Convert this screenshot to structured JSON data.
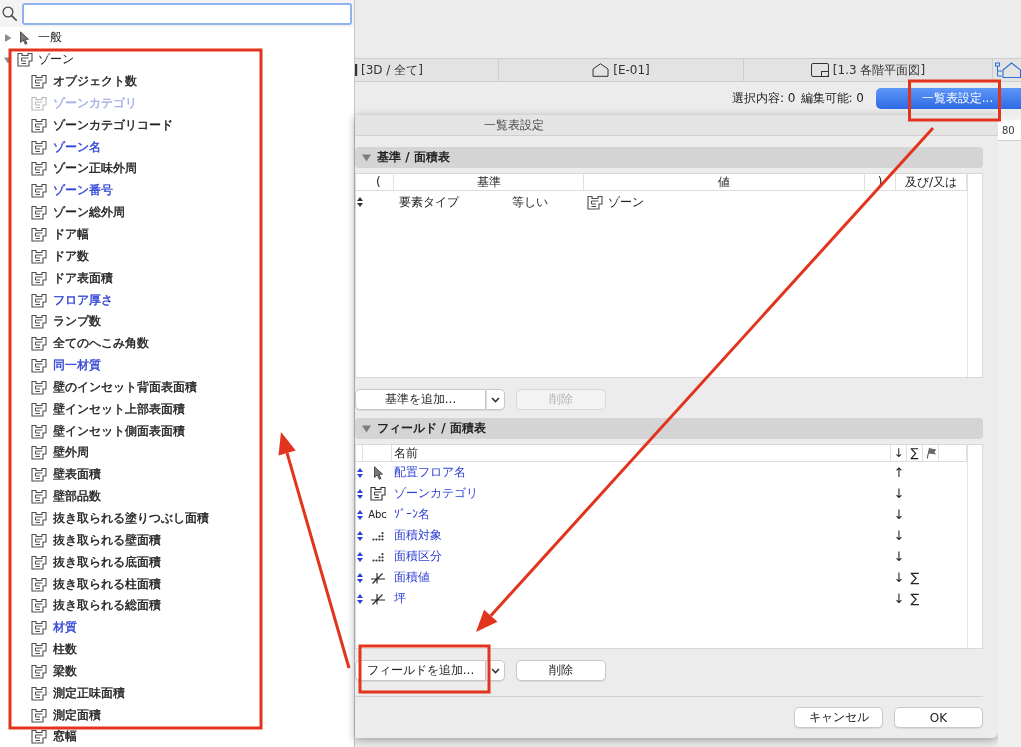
{
  "tree": [
    {
      "label": "一般",
      "kind": "general",
      "expanded": false
    },
    {
      "label": "ゾーン",
      "kind": "zone",
      "expanded": true,
      "children": [
        {
          "label": "オブジェクト数",
          "color": "#222222",
          "disabled": false
        },
        {
          "label": "ゾーンカテゴリ",
          "color": "#a5afe8",
          "disabled": true
        },
        {
          "label": "ゾーンカテゴリコード",
          "color": "#222222",
          "disabled": false
        },
        {
          "label": "ゾーン名",
          "color": "#3347d6",
          "disabled": false
        },
        {
          "label": "ゾーン正味外周",
          "color": "#222222",
          "disabled": false
        },
        {
          "label": "ゾーン番号",
          "color": "#3347d6",
          "disabled": false
        },
        {
          "label": "ゾーン総外周",
          "color": "#222222",
          "disabled": false
        },
        {
          "label": "ドア幅",
          "color": "#222222",
          "disabled": false
        },
        {
          "label": "ドア数",
          "color": "#222222",
          "disabled": false
        },
        {
          "label": "ドア表面積",
          "color": "#222222",
          "disabled": false
        },
        {
          "label": "フロア厚さ",
          "color": "#3347d6",
          "disabled": false
        },
        {
          "label": "ランプ数",
          "color": "#222222",
          "disabled": false
        },
        {
          "label": "全てのへこみ角数",
          "color": "#222222",
          "disabled": false
        },
        {
          "label": "同一材質",
          "color": "#3347d6",
          "disabled": false
        },
        {
          "label": "壁のインセット背面表面積",
          "color": "#222222",
          "disabled": false
        },
        {
          "label": "壁インセット上部表面積",
          "color": "#222222",
          "disabled": false
        },
        {
          "label": "壁インセット側面表面積",
          "color": "#222222",
          "disabled": false
        },
        {
          "label": "壁外周",
          "color": "#222222",
          "disabled": false
        },
        {
          "label": "壁表面積",
          "color": "#222222",
          "disabled": false
        },
        {
          "label": "壁部品数",
          "color": "#222222",
          "disabled": false
        },
        {
          "label": "抜き取られる塗りつぶし面積",
          "color": "#222222",
          "disabled": false
        },
        {
          "label": "抜き取られる壁面積",
          "color": "#222222",
          "disabled": false
        },
        {
          "label": "抜き取られる底面積",
          "color": "#222222",
          "disabled": false
        },
        {
          "label": "抜き取られる柱面積",
          "color": "#222222",
          "disabled": false
        },
        {
          "label": "抜き取られる総面積",
          "color": "#222222",
          "disabled": false
        },
        {
          "label": "材質",
          "color": "#3347d6",
          "disabled": false
        },
        {
          "label": "柱数",
          "color": "#222222",
          "disabled": false
        },
        {
          "label": "梁数",
          "color": "#222222",
          "disabled": false
        },
        {
          "label": "測定正味面積",
          "color": "#222222",
          "disabled": false
        },
        {
          "label": "測定面積",
          "color": "#222222",
          "disabled": false
        },
        {
          "label": "窓幅",
          "color": "#222222",
          "disabled": false
        }
      ]
    }
  ],
  "view_tabs": [
    {
      "label": "[3D / 全て]",
      "kind": "model",
      "selected": false
    },
    {
      "label": "[E-01]",
      "kind": "elevation",
      "selected": false
    },
    {
      "label": "[1.3 各階平面図]",
      "kind": "plan",
      "selected": false
    }
  ],
  "toolbar": {
    "selection": "選択内容: 0",
    "editable": "編集可能: 0",
    "settings_button": "一覧表設定..."
  },
  "dialog": {
    "title": "一覧表設定",
    "criteria": {
      "title": "基準 / 面積表",
      "expanded": true,
      "columns": [
        "(",
        "基準",
        "値",
        ")",
        "及び/又は"
      ],
      "rows": [
        {
          "criterion": "要素タイプ",
          "operator": "等しい",
          "value": "ゾーン",
          "kind": "zone"
        }
      ],
      "add_button": "基準を追加...",
      "delete_button": {
        "label": "削除",
        "disabled": true
      }
    },
    "fields": {
      "title": "フィールド / 面積表",
      "expanded": true,
      "columns": {
        "name": "名前",
        "sort": "↓",
        "sum": "∑"
      },
      "rows": [
        {
          "kind": "element",
          "name": "配置フロア名",
          "sort": "↑"
        },
        {
          "kind": "zone",
          "name": "ゾーンカテゴリ",
          "sort": "↓"
        },
        {
          "kind": "text",
          "icon_text": "Abc",
          "name": "ｿﾞｰﾝ名",
          "sort": "↓"
        },
        {
          "kind": "property",
          "name": "面積対象",
          "sort": "↓"
        },
        {
          "kind": "property",
          "name": "面積区分",
          "sort": "↓"
        },
        {
          "kind": "calculation",
          "name": "面積値",
          "sort": "↓",
          "sum": "∑"
        },
        {
          "kind": "calculation",
          "name": "坪",
          "sort": "↓",
          "sum": "∑"
        }
      ],
      "add_button": "フィールドを追加...",
      "delete_button": {
        "label": "削除",
        "disabled": false
      }
    },
    "buttons": [
      "キャンセル",
      "OK"
    ]
  },
  "ruler": {
    "label": "80"
  }
}
